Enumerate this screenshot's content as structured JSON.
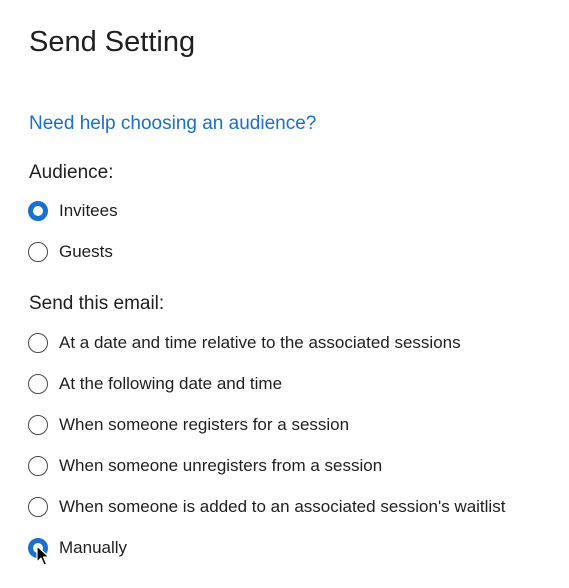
{
  "page": {
    "title": "Send Setting",
    "help_link": "Need help choosing an audience?"
  },
  "audience": {
    "label": "Audience:",
    "options": [
      {
        "label": "Invitees",
        "checked": true
      },
      {
        "label": "Guests",
        "checked": false
      }
    ]
  },
  "send": {
    "label": "Send this email:",
    "options": [
      {
        "label": "At a date and time relative to the associated sessions",
        "checked": false
      },
      {
        "label": "At the following date and time",
        "checked": false
      },
      {
        "label": "When someone registers for a session",
        "checked": false
      },
      {
        "label": "When someone unregisters from a session",
        "checked": false
      },
      {
        "label": "When someone is added to an associated session's waitlist",
        "checked": false
      },
      {
        "label": "Manually",
        "checked": true
      }
    ]
  },
  "colors": {
    "accent": "#1a6fd1",
    "text": "#1f1f1f",
    "radio_border": "#4a4a4a"
  },
  "icons": {
    "pointer": "mouse-pointer-icon"
  }
}
